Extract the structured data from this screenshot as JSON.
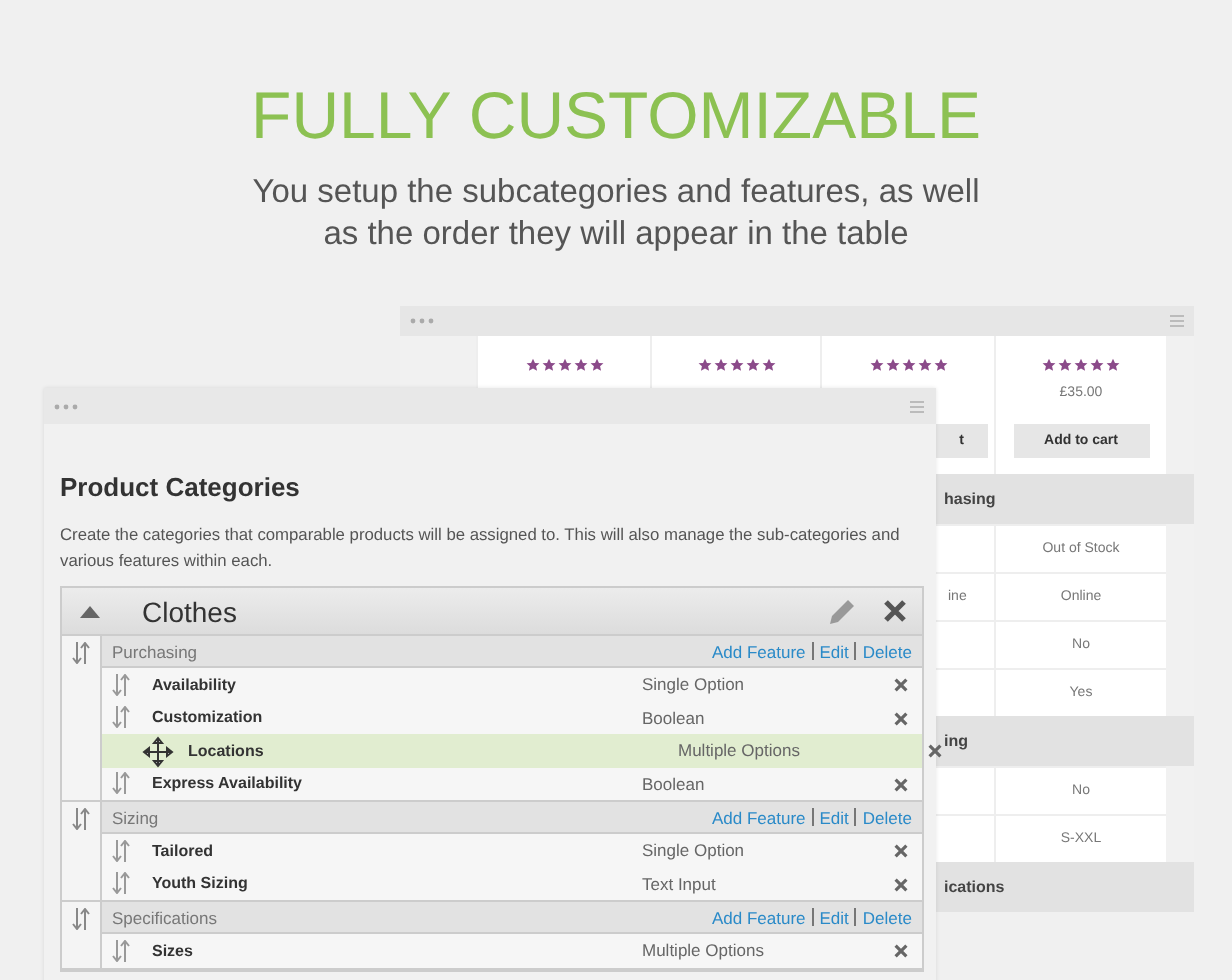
{
  "headline": "FULLY CUSTOMIZABLE",
  "subheading": "You setup the subcategories and features, as well as the order they will appear in the table",
  "comparison_window": {
    "products": [
      {
        "stars": 5
      },
      {
        "stars": 5
      },
      {
        "stars": 5,
        "button": "t"
      },
      {
        "stars": 5,
        "price": "£35.00",
        "button": "Add to cart"
      }
    ],
    "sections": [
      {
        "label": "hasing",
        "rows": [
          {
            "column_4": "Out of Stock"
          },
          {
            "column_3": "ine",
            "column_4": "Online"
          },
          {
            "column_4": "No"
          },
          {
            "column_4": "Yes"
          }
        ]
      },
      {
        "label": "ing",
        "rows": [
          {
            "column_4": "No"
          },
          {
            "column_4": "S-XXL"
          }
        ]
      },
      {
        "label": "ications"
      }
    ]
  },
  "categories_window": {
    "title": "Product Categories",
    "description": "Create the categories that comparable products will be assigned to. This will also manage the sub-categories and various features within each.",
    "category": {
      "name": "Clothes",
      "expanded": true
    },
    "groups": [
      {
        "name": "Purchasing",
        "actions": [
          "Add Feature",
          "Edit",
          "Delete"
        ],
        "features": [
          {
            "name": "Availability",
            "type": "Single Option",
            "dragging": false
          },
          {
            "name": "Customization",
            "type": "Boolean",
            "dragging": false
          },
          {
            "name": "Locations",
            "type": "Multiple Options",
            "dragging": true
          },
          {
            "name": "Express Availability",
            "type": "Boolean",
            "dragging": false
          }
        ]
      },
      {
        "name": "Sizing",
        "actions": [
          "Add Feature",
          "Edit",
          "Delete"
        ],
        "features": [
          {
            "name": "Tailored",
            "type": "Single Option",
            "dragging": false
          },
          {
            "name": "Youth Sizing",
            "type": "Text Input",
            "dragging": false
          }
        ]
      },
      {
        "name": "Specifications",
        "actions": [
          "Add Feature",
          "Edit",
          "Delete"
        ],
        "features": [
          {
            "name": "Sizes",
            "type": "Multiple Options",
            "dragging": false
          }
        ]
      }
    ]
  }
}
